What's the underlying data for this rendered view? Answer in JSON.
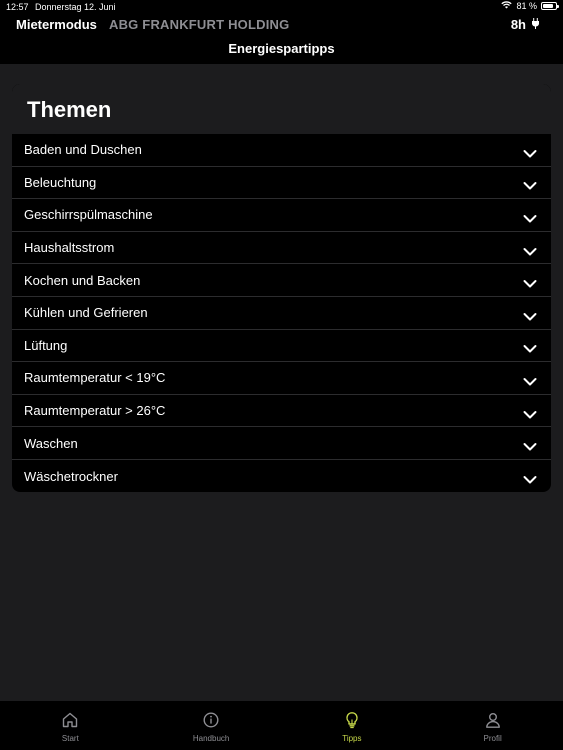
{
  "status_bar": {
    "time": "12:57",
    "date": "Donnerstag 12. Juni",
    "battery_text": "81 %",
    "battery_level": 0.81
  },
  "header": {
    "mode": "Mietermodus",
    "org": "ABG FRANKFURT HOLDING",
    "hours": "8h",
    "title": "Energiespartipps"
  },
  "themes": {
    "heading": "Themen",
    "items": [
      {
        "label": "Baden und Duschen"
      },
      {
        "label": "Beleuchtung"
      },
      {
        "label": "Geschirrspülmaschine"
      },
      {
        "label": "Haushaltsstrom"
      },
      {
        "label": "Kochen und Backen"
      },
      {
        "label": "Kühlen und Gefrieren"
      },
      {
        "label": "Lüftung"
      },
      {
        "label": "Raumtemperatur < 19°C"
      },
      {
        "label": "Raumtemperatur > 26°C"
      },
      {
        "label": "Waschen"
      },
      {
        "label": "Wäschetrockner"
      }
    ]
  },
  "tabbar": {
    "items": [
      {
        "label": "Start",
        "icon": "home-icon"
      },
      {
        "label": "Handbuch",
        "icon": "info-icon"
      },
      {
        "label": "Tipps",
        "icon": "lightbulb-icon",
        "active": true
      },
      {
        "label": "Profil",
        "icon": "person-icon"
      }
    ]
  },
  "colors": {
    "background": "#1c1c1e",
    "surface": "#000000",
    "accent": "#c8d94a",
    "muted": "#8e8e93"
  }
}
